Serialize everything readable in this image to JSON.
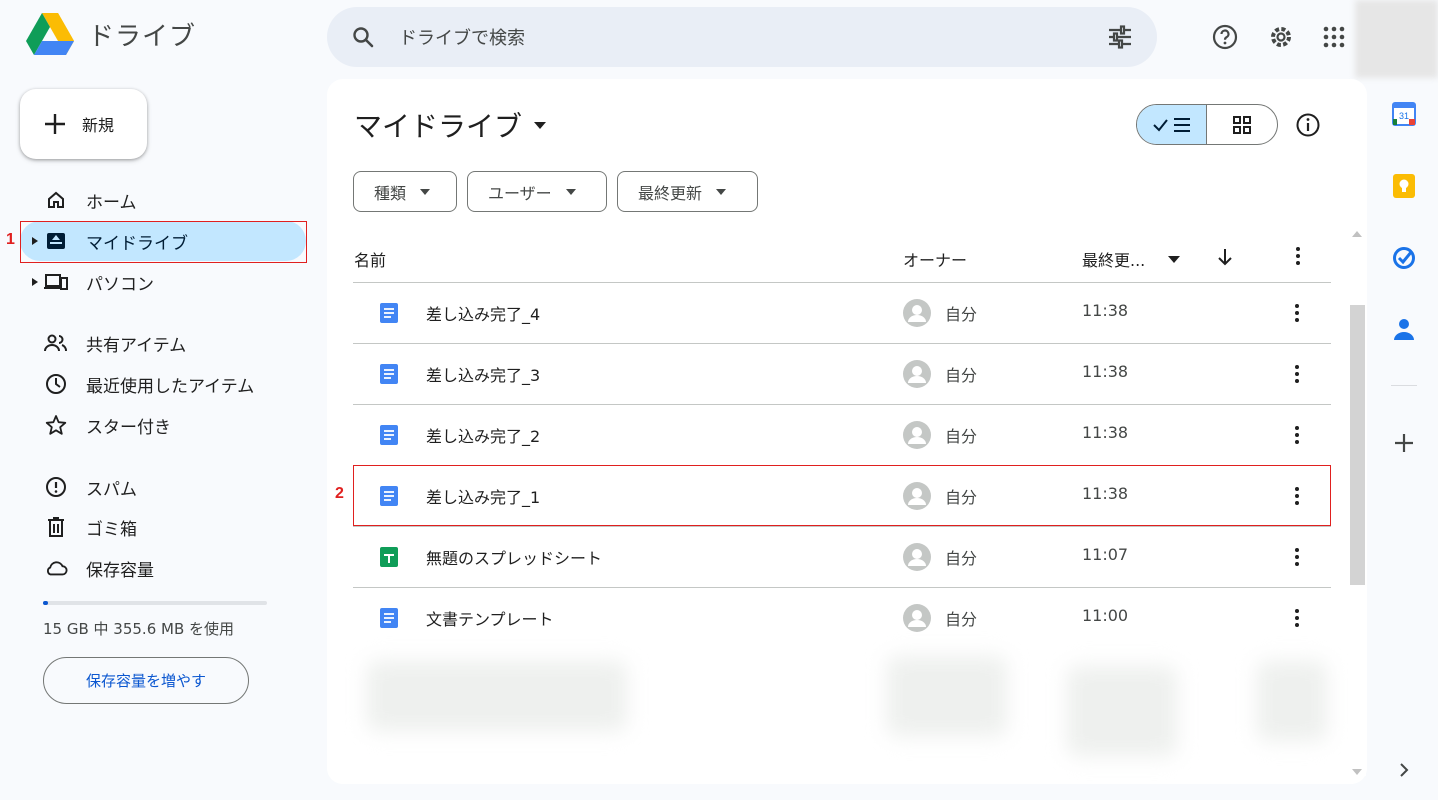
{
  "app": {
    "name": "ドライブ"
  },
  "search": {
    "placeholder": "ドライブで検索"
  },
  "new_button": {
    "label": "新規"
  },
  "nav": {
    "items": [
      {
        "label": "ホーム",
        "icon": "home-icon"
      },
      {
        "label": "マイドライブ",
        "icon": "my-drive-icon",
        "active": true
      },
      {
        "label": "パソコン",
        "icon": "computers-icon"
      },
      {
        "label": "共有アイテム",
        "icon": "shared-icon"
      },
      {
        "label": "最近使用したアイテム",
        "icon": "clock-icon"
      },
      {
        "label": "スター付き",
        "icon": "star-icon"
      },
      {
        "label": "スパム",
        "icon": "spam-icon"
      },
      {
        "label": "ゴミ箱",
        "icon": "trash-icon"
      },
      {
        "label": "保存容量",
        "icon": "cloud-icon"
      }
    ]
  },
  "storage": {
    "used_fraction": 0.024,
    "text": "15 GB 中 355.6 MB を使用",
    "button": "保存容量を増やす"
  },
  "main": {
    "title": "マイドライブ",
    "filters": [
      "種類",
      "ユーザー",
      "最終更新"
    ],
    "columns": {
      "name": "名前",
      "owner": "オーナー",
      "modified": "最終更..."
    },
    "files": [
      {
        "name": "差し込み完了_4",
        "type": "doc",
        "owner": "自分",
        "time": "11:38"
      },
      {
        "name": "差し込み完了_3",
        "type": "doc",
        "owner": "自分",
        "time": "11:38"
      },
      {
        "name": "差し込み完了_2",
        "type": "doc",
        "owner": "自分",
        "time": "11:38"
      },
      {
        "name": "差し込み完了_1",
        "type": "doc",
        "owner": "自分",
        "time": "11:38"
      },
      {
        "name": "無題のスプレッドシート",
        "type": "sheet",
        "owner": "自分",
        "time": "11:07"
      },
      {
        "name": "文書テンプレート",
        "type": "doc",
        "owner": "自分",
        "time": "11:00"
      }
    ]
  },
  "annotations": {
    "mark1": "1",
    "mark2": "2"
  },
  "colors": {
    "accent": "#0b57d0",
    "active_nav": "#c2e7ff",
    "doc": "#4285f4",
    "sheet": "#0f9d58",
    "marker": "#e0201f"
  },
  "side_panel": {
    "calendar_day": "31"
  }
}
